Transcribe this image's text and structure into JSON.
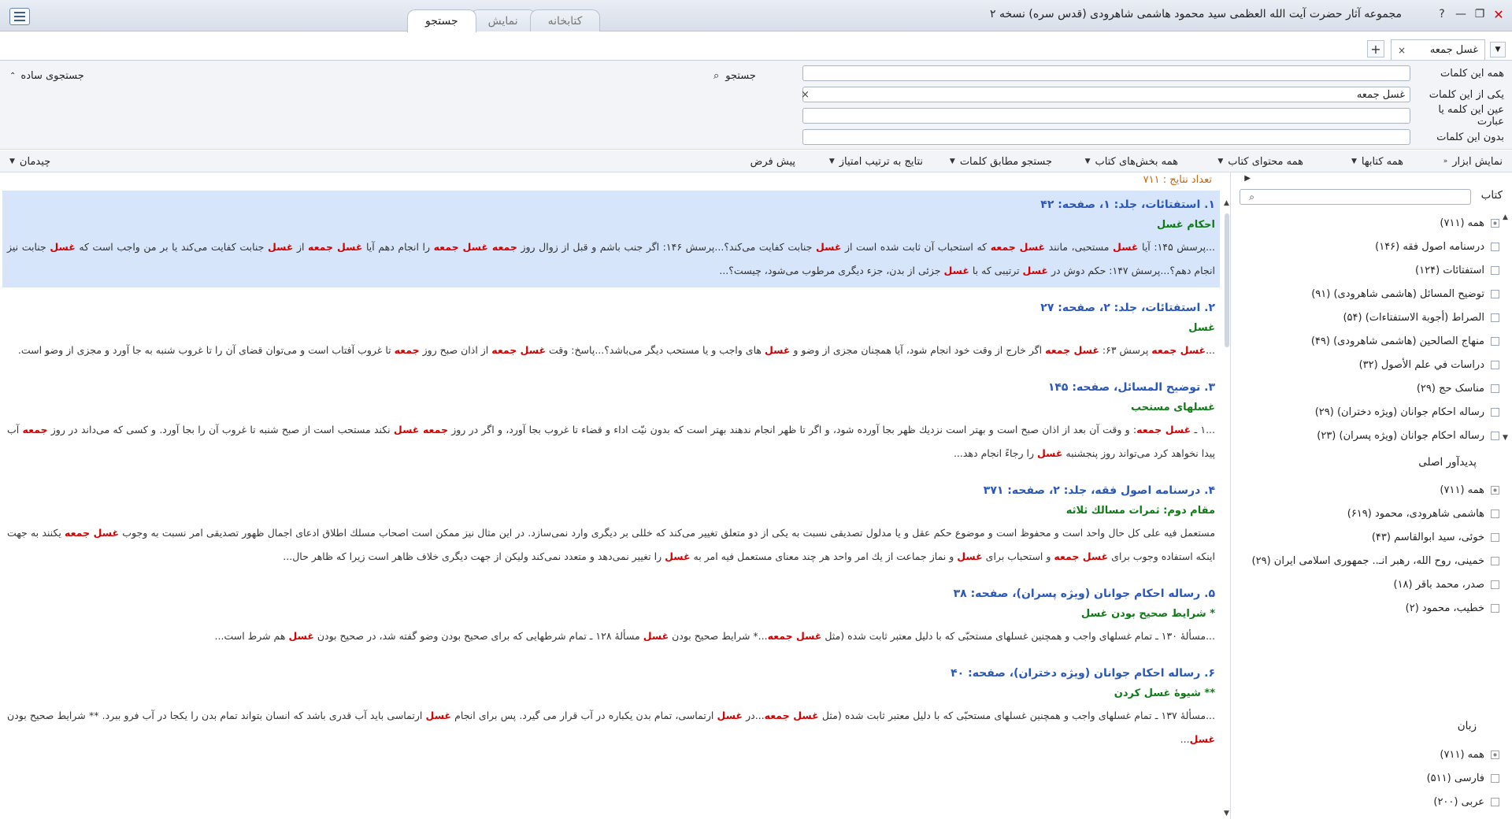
{
  "window": {
    "title": "مجموعه آثار حضرت آیت الله العظمی سید محمود هاشمی شاهرودی (قدس سره) نسخه ۲",
    "help": "?",
    "minimize": "—",
    "restore": "❐",
    "close": "✕"
  },
  "main_tabs": [
    {
      "label": "جستجو"
    },
    {
      "label": "نمایش"
    },
    {
      "label": "کتابخانه"
    }
  ],
  "doc_tab": {
    "label": "غسل جمعه",
    "close": "×",
    "add": "+"
  },
  "search": {
    "fields": [
      {
        "label": "همه این کلمات",
        "value": ""
      },
      {
        "label": "یکی از این کلمات",
        "value": "غسل جمعه",
        "clear": "×"
      },
      {
        "label": "عین این کلمه یا عبارت",
        "value": ""
      },
      {
        "label": "بدون این کلمات",
        "value": ""
      }
    ],
    "search_button": "جستجو",
    "simple_search": "جستجوی ساده"
  },
  "toolbar": {
    "show_tools": "نمایش ابزار",
    "all_books": "همه کتابها",
    "all_book_content": "همه محتوای کتاب",
    "all_book_sections": "همه بخش‌های کتاب",
    "word_match": "جستجو مطابق کلمات",
    "sort_by_score": "نتایج به ترتیب امتیاز",
    "default": "پیش فرض",
    "layout": "چیدمان"
  },
  "results": {
    "count_label": "تعداد نتایج : ۷۱۱",
    "items": [
      {
        "title": "۱. استفتائات، جلد: ۱، صفحه: ۴۲",
        "subtitle": "احکام غسل",
        "snippet_html": "...پرسش ۱۴۵: آیا <b>غسل</b> مستحبی، مانند <b>غسل جمعه</b> که استحباب آن ثابت شده است از <b>غسل</b> جنابت کفایت می‌کند؟...پرسش ۱۴۶: اگر جنب باشم و قبل از زوال روز <b>جمعه غسل جمعه</b> را انجام دهم آیا <b>غسل جمعه</b> از <b>غسل</b> جنابت کفایت می‌کند یا بر من واجب است که <b>غسل</b> جنابت نیز انجام دهم؟...پرسش ۱۴۷: حکم دوش در <b>غسل</b> ترتیبی که با <b>غسل</b> جزئی از بدن، جزء دیگری مرطوب می‌شود، چیست؟..."
      },
      {
        "title": "۲. استفتائات، جلد: ۲، صفحه: ۲۷",
        "subtitle": "غسل",
        "snippet_html": "...<b>غسل جمعه</b> پرسش ۶۳: <b>غسل جمعه</b> اگر خارج از وقت خود انجام شود، آیا همچنان مجزی از وضو و <b>غسل</b> های واجب و یا مستحب دیگر می‌باشد؟...پاسخ: وقت <b>غسل جمعه</b> از اذان صبح روز <b>جمعه</b> تا غروب آفتاب است و می‌توان قضای آن را تا غروب شنبه به جا آورد و مجزی از وضو است."
      },
      {
        "title": "۳. توضیح المسائل، صفحه: ۱۴۵",
        "subtitle": "غسلهای مستحب",
        "snippet_html": "...۱ ـ <b>غسل جمعه</b>: و وقت آن بعد از اذان صبح است و بهتر است نزدیك ظهر بجا آورده شود، و اگر تا ظهر انجام ندهند بهتر است که بدون نیّت اداء و قضاء تا غروب بجا آورد، و اگر در روز <b>جمعه غسل</b> نکند مستحب است از صبح شنبه تا غروب آن را بجا آورد. و کسی که می‌داند در روز <b>جمعه</b> آب پیدا نخواهد کرد می‌تواند روز پنجشنبه <b>غسل</b> را رجاءً انجام دهد..."
      },
      {
        "title": "۴. درسنامه اصول فقه، جلد: ۲، صفحه: ۳۷۱",
        "subtitle": "مقام دوم: ثمرات مسالك ثلاثه",
        "snippet_html": "مستعمل فيه على كل حال واحد است و محفوظ است و موضوع حکم عقل و یا مدلول تصدیقی نسبت به یکی از دو متعلق تغییر می‌کند که خللی بر دیگری وارد نمی‌سازد. در این مثال نیز ممکن است اصحاب مسلك اطلاق ادعای اجمال ظهور تصدیقی امر نسبت به وجوب <b>غسل جمعه</b> یکنند به جهت اینکه استفاده وجوب برای <b>غسل جمعه</b> و استحباب برای <b>غسل</b> و نماز جماعت از يك امر واحد هر چند معنای مستعمل فيه امر به <b>غسل</b> را تغییر نمی‌دهد و متعدد نمی‌کند ولیکن از جهت دیگری خلاف ظاهر است زیرا که ظاهر حال..."
      },
      {
        "title": "۵. رساله احکام جوانان (ویژه پسران)، صفحه: ۳۸",
        "subtitle": "* شرایط صحیح بودن غسل",
        "snippet_html": "...مسألهٔ ۱۳۰ ـ تمام غسلهای واجب و همچنین غسلهای مستحبّی که با دلیل معتبر ثابت شده (مثل <b>غسل جمعه</b>...* شرایط صحیح بودن <b>غسل</b> مسألهٔ ۱۲۸ ـ تمام شرطهایی که برای صحیح بودن وضو گفته شد، در صحیح بودن <b>غسل</b> هم شرط است..."
      },
      {
        "title": "۶. رساله احکام جوانان (ویژه دختران)، صفحه: ۴۰",
        "subtitle": "** شیوهٔ غسل کردن",
        "snippet_html": "...مسألهٔ ۱۳۷ ـ تمام غسلهای واجب و همچنین غسلهای مستحبّی که با دلیل معتبر ثابت شده (مثل <b>غسل جمعه</b>...در <b>غسل</b> ارتماسی، تمام بدن یکباره در آب قرار می گیرد. پس برای انجام <b>غسل</b> ارتماسی باید آب قدری باشد که انسان بتواند تمام بدن را یکجا در آب فرو ببرد. ** شرایط صحیح بودن <b>غسل</b>..."
      }
    ]
  },
  "sidebar": {
    "books_label": "کتاب",
    "books": [
      {
        "label": "همه (۷۱۱)"
      },
      {
        "label": "درسنامه اصول فقه (۱۴۶)"
      },
      {
        "label": "استفتائات (۱۲۴)"
      },
      {
        "label": "توضیح المسائل (هاشمی شاهرودی) (۹۱)"
      },
      {
        "label": "الصراط (أجوبة الاستفتاءات) (۵۴)"
      },
      {
        "label": "منهاج الصالحين (هاشمی شاهرودی) (۴۹)"
      },
      {
        "label": "دراسات في علم الأصول (۳۲)"
      },
      {
        "label": "مناسک حج (۲۹)"
      },
      {
        "label": "رساله احکام جوانان (ویژه دختران) (۲۹)"
      },
      {
        "label": "رساله احکام جوانان (ویژه پسران) (۲۳)"
      }
    ],
    "authors_label": "پدیدآور اصلی",
    "authors": [
      {
        "label": "همه (۷۱۱)"
      },
      {
        "label": "هاشمی شاهرودی، محمود (۶۱۹)"
      },
      {
        "label": "خوئی، سید ابوالقاسم (۴۳)"
      },
      {
        "label": "خمینی، روح الله، رهبر انـ.. جمهوری اسلامی ایران (۲۹)"
      },
      {
        "label": "صدر، محمد باقر (۱۸)"
      },
      {
        "label": "خطیب، محمود (۲)"
      }
    ],
    "language_label": "زبان",
    "languages": [
      {
        "label": "همه (۷۱۱)"
      },
      {
        "label": "فارسی (۵۱۱)"
      },
      {
        "label": "عربی (۲۰۰)"
      }
    ]
  }
}
